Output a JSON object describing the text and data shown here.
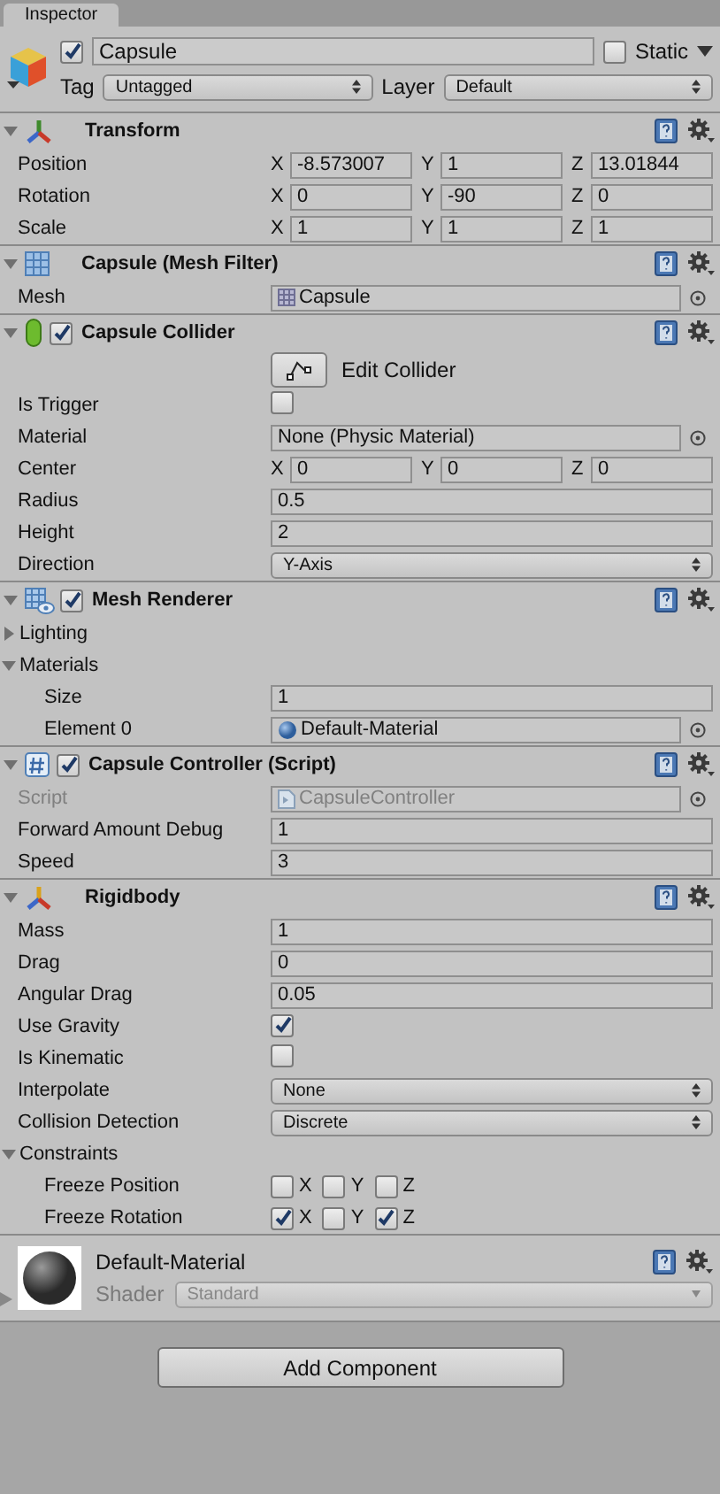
{
  "tab": {
    "title": "Inspector"
  },
  "object": {
    "active": true,
    "name": "Capsule",
    "static": false,
    "static_label": "Static",
    "tag_label": "Tag",
    "tag": "Untagged",
    "layer_label": "Layer",
    "layer": "Default"
  },
  "components": [
    {
      "kind": "transform",
      "title": "Transform",
      "expanded": true,
      "rows": [
        {
          "kind": "vector",
          "label": "Position",
          "fields": [
            {
              "axis": "X",
              "value": "-8.573007"
            },
            {
              "axis": "Y",
              "value": "1"
            },
            {
              "axis": "Z",
              "value": "13.01844"
            }
          ]
        },
        {
          "kind": "vector",
          "label": "Rotation",
          "fields": [
            {
              "axis": "X",
              "value": "0"
            },
            {
              "axis": "Y",
              "value": "-90"
            },
            {
              "axis": "Z",
              "value": "0"
            }
          ]
        },
        {
          "kind": "vector",
          "label": "Scale",
          "fields": [
            {
              "axis": "X",
              "value": "1"
            },
            {
              "axis": "Y",
              "value": "1"
            },
            {
              "axis": "Z",
              "value": "1"
            }
          ]
        }
      ]
    },
    {
      "kind": "mesh",
      "title": "Capsule (Mesh Filter)",
      "expanded": true,
      "rows": [
        {
          "kind": "mesh_ref",
          "label": "Mesh",
          "value": "Capsule",
          "disabled": false
        }
      ]
    },
    {
      "kind": "capsule",
      "title": "Capsule Collider",
      "enabled": true,
      "expanded": true,
      "rows": [
        {
          "kind": "button",
          "label": "Edit Collider"
        },
        {
          "kind": "checkbox",
          "label": "Is Trigger",
          "checked": false
        },
        {
          "kind": "object",
          "label": "Material",
          "value": "None (Physic Material)",
          "disabled": false
        },
        {
          "kind": "vector",
          "label": "Center",
          "fields": [
            {
              "axis": "X",
              "value": "0"
            },
            {
              "axis": "Y",
              "value": "0"
            },
            {
              "axis": "Z",
              "value": "0"
            }
          ]
        },
        {
          "kind": "text",
          "label": "Radius",
          "value": "0.5"
        },
        {
          "kind": "text",
          "label": "Height",
          "value": "2"
        },
        {
          "kind": "dropdown",
          "label": "Direction",
          "value": "Y-Axis"
        }
      ]
    },
    {
      "kind": "renderer",
      "title": "Mesh Renderer",
      "enabled": true,
      "expanded": true,
      "rows": [
        {
          "kind": "foldout",
          "label": "Lighting",
          "expanded": false
        },
        {
          "kind": "foldout",
          "label": "Materials",
          "expanded": true,
          "children": [
            {
              "kind": "text",
              "label": "Size",
              "value": "1"
            },
            {
              "kind": "material_ref",
              "label": "Element 0",
              "value": "Default-Material",
              "disabled": false
            }
          ]
        }
      ]
    },
    {
      "kind": "script",
      "title": "Capsule Controller (Script)",
      "enabled": true,
      "expanded": true,
      "rows": [
        {
          "kind": "script_ref",
          "label": "Script",
          "value": "CapsuleController",
          "disabled": true
        },
        {
          "kind": "text",
          "label": "Forward Amount Debug",
          "value": "1"
        },
        {
          "kind": "text",
          "label": "Speed",
          "value": "3"
        }
      ]
    },
    {
      "kind": "rigidbody",
      "title": "Rigidbody",
      "expanded": true,
      "rows": [
        {
          "kind": "text",
          "label": "Mass",
          "value": "1"
        },
        {
          "kind": "text",
          "label": "Drag",
          "value": "0"
        },
        {
          "kind": "text",
          "label": "Angular Drag",
          "value": "0.05"
        },
        {
          "kind": "checkbox",
          "label": "Use Gravity",
          "checked": true
        },
        {
          "kind": "checkbox",
          "label": "Is Kinematic",
          "checked": false
        },
        {
          "kind": "dropdown",
          "label": "Interpolate",
          "value": "None"
        },
        {
          "kind": "dropdown",
          "label": "Collision Detection",
          "value": "Discrete"
        },
        {
          "kind": "foldout",
          "label": "Constraints",
          "expanded": true,
          "children": [
            {
              "kind": "toggles",
              "label": "Freeze Position",
              "toggles": [
                {
                  "axis": "X",
                  "checked": false
                },
                {
                  "axis": "Y",
                  "checked": false
                },
                {
                  "axis": "Z",
                  "checked": false
                }
              ]
            },
            {
              "kind": "toggles",
              "label": "Freeze Rotation",
              "toggles": [
                {
                  "axis": "X",
                  "checked": true
                },
                {
                  "axis": "Y",
                  "checked": false
                },
                {
                  "axis": "Z",
                  "checked": true
                }
              ]
            }
          ]
        }
      ]
    }
  ],
  "material": {
    "name": "Default-Material",
    "shader_label": "Shader",
    "shader": "Standard"
  },
  "add_button": "Add Component"
}
